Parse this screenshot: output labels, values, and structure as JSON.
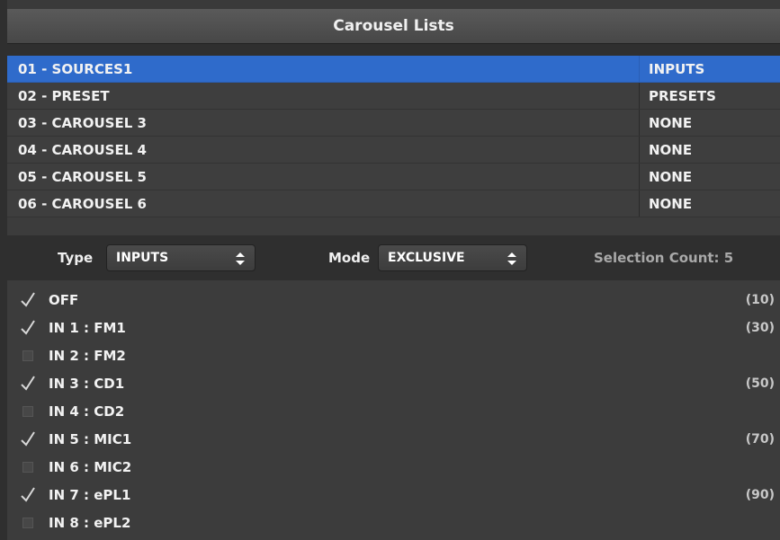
{
  "window": {
    "title": "Carousel Lists"
  },
  "carousels": [
    {
      "name": "01 - SOURCES1",
      "type": "INPUTS",
      "selected": true
    },
    {
      "name": "02 - PRESET",
      "type": "PRESETS",
      "selected": false
    },
    {
      "name": "03 - CAROUSEL 3",
      "type": "NONE",
      "selected": false
    },
    {
      "name": "04 - CAROUSEL 4",
      "type": "NONE",
      "selected": false
    },
    {
      "name": "05 - CAROUSEL 5",
      "type": "NONE",
      "selected": false
    },
    {
      "name": "06 - CAROUSEL 6",
      "type": "NONE",
      "selected": false
    }
  ],
  "controls": {
    "type_label": "Type",
    "type_value": "INPUTS",
    "mode_label": "Mode",
    "mode_value": "EXCLUSIVE",
    "selection_count": "Selection Count: 5"
  },
  "inputs": [
    {
      "label": "OFF",
      "checked": true,
      "value": "(10)"
    },
    {
      "label": "IN 1 : FM1",
      "checked": true,
      "value": "(30)"
    },
    {
      "label": "IN 2 : FM2",
      "checked": false,
      "value": ""
    },
    {
      "label": "IN 3 : CD1",
      "checked": true,
      "value": "(50)"
    },
    {
      "label": "IN 4 : CD2",
      "checked": false,
      "value": ""
    },
    {
      "label": "IN 5 : MIC1",
      "checked": true,
      "value": "(70)"
    },
    {
      "label": "IN 6 : MIC2",
      "checked": false,
      "value": ""
    },
    {
      "label": "IN 7 : ePL1",
      "checked": true,
      "value": "(90)"
    },
    {
      "label": "IN 8 : ePL2",
      "checked": false,
      "value": ""
    }
  ],
  "colors": {
    "selection": "#2f6bcb",
    "background": "#2f2f2f",
    "list": "#3c3c3c"
  },
  "icons": {
    "checked": "checkmark-icon",
    "unchecked": "checkbox-icon",
    "select": "updown-arrows-icon"
  }
}
